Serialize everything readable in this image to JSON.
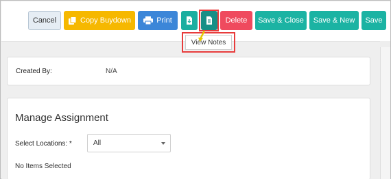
{
  "toolbar": {
    "cancel_label": "Cancel",
    "copy_buydown_label": "Copy Buydown",
    "print_label": "Print",
    "delete_label": "Delete",
    "save_close_label": "Save & Close",
    "save_new_label": "Save & New",
    "save_label": "Save"
  },
  "tooltip": {
    "text": "View Notes"
  },
  "details": {
    "created_by_label": "Created By:",
    "created_by_value": "N/A"
  },
  "assignment": {
    "title": "Manage Assignment",
    "locations_label": "Select Locations: *",
    "locations_value": "All",
    "empty_message": "No Items Selected"
  },
  "colors": {
    "warning": "#f6b800",
    "primary": "#3c86d8",
    "teal": "#1bb3a3",
    "danger": "#ef4a5e",
    "highlight": "#e83b3b"
  },
  "icons": {
    "copy": "copy-icon",
    "print": "print-icon",
    "download": "download-icon",
    "notes": "notes-icon"
  }
}
